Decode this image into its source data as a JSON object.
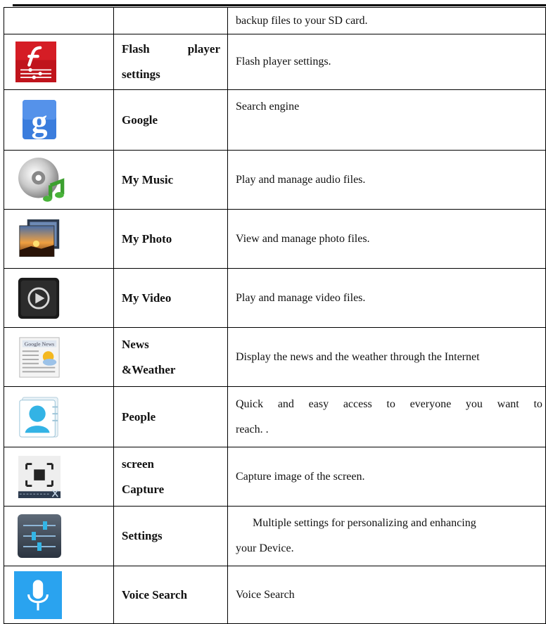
{
  "rows": [
    {
      "name1": "",
      "name2": "",
      "desc1": "backup files to your SD card.",
      "desc2": ""
    },
    {
      "name1": "Flash player",
      "name2": "settings",
      "desc1": "Flash player settings.",
      "desc2": "",
      "icon": "flash-player-icon"
    },
    {
      "name1": "Google",
      "name2": "",
      "desc1": "Search engine",
      "desc2": "",
      "icon": "google-search-icon"
    },
    {
      "name1": "My Music",
      "name2": "",
      "desc1": "Play and manage audio files.",
      "desc2": "",
      "icon": "music-cd-icon"
    },
    {
      "name1": "My Photo",
      "name2": "",
      "desc1": "View and manage photo files.",
      "desc2": "",
      "icon": "photo-gallery-icon"
    },
    {
      "name1": "My Video",
      "name2": "",
      "desc1": "Play and manage video files.",
      "desc2": "",
      "icon": "video-play-icon"
    },
    {
      "name1": "News",
      "name2": "&Weather",
      "desc1": "Display the news and the weather through the Internet",
      "desc2": "",
      "icon": "news-weather-icon"
    },
    {
      "name1": "People",
      "name2": "",
      "desc1": "Quick and easy access to everyone you want to",
      "desc2": "reach. .",
      "icon": "people-contact-icon"
    },
    {
      "name1": "screen",
      "name2": "Capture",
      "desc1": "Capture image of the screen.",
      "desc2": "",
      "icon": "screen-capture-icon"
    },
    {
      "name1": "Settings",
      "name2": "",
      "desc1": "Multiple settings for personalizing and enhancing",
      "desc2": "your Device.",
      "icon": "settings-sliders-icon"
    },
    {
      "name1": "Voice Search",
      "name2": "",
      "desc1": "Voice Search",
      "desc2": "",
      "icon": "microphone-icon"
    }
  ]
}
